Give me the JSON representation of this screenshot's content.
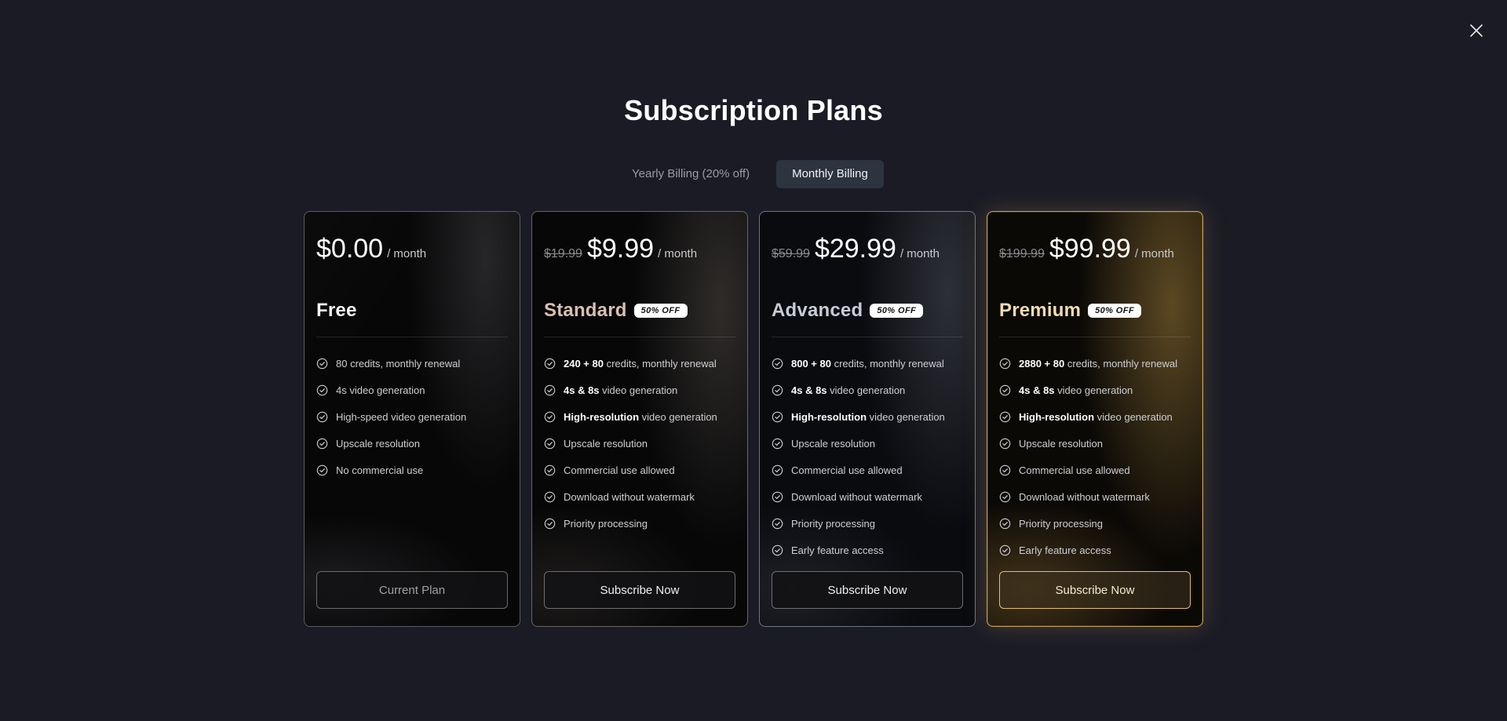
{
  "title": "Subscription Plans",
  "billing": {
    "yearly_label": "Yearly Billing (20% off)",
    "monthly_label": "Monthly Billing",
    "selected": "monthly"
  },
  "icons": {
    "close": "close-icon",
    "check": "check-circle-icon"
  },
  "colors": {
    "background": "#1b1b26",
    "premium_accent": "#c7a25d",
    "toggle_active": "#2c3440"
  },
  "plans": [
    {
      "name": "Free",
      "old_price": "",
      "price": "$0.00",
      "per": "/ month",
      "badge": "",
      "features": [
        {
          "bold": "",
          "text": "80 credits, monthly renewal"
        },
        {
          "bold": "",
          "text": "4s video generation"
        },
        {
          "bold": "",
          "text": "High-speed video generation"
        },
        {
          "bold": "",
          "text": "Upscale resolution"
        },
        {
          "bold": "",
          "text": "No commercial use"
        }
      ],
      "cta": "Current Plan"
    },
    {
      "name": "Standard",
      "old_price": "$19.99",
      "price": "$9.99",
      "per": "/ month",
      "badge": "50% OFF",
      "features": [
        {
          "bold": "240 + 80",
          "text": " credits, monthly renewal"
        },
        {
          "bold": "4s & 8s",
          "text": " video generation"
        },
        {
          "bold": "High-resolution",
          "text": " video generation"
        },
        {
          "bold": "",
          "text": "Upscale resolution"
        },
        {
          "bold": "",
          "text": "Commercial use allowed"
        },
        {
          "bold": "",
          "text": "Download without watermark"
        },
        {
          "bold": "",
          "text": "Priority processing"
        }
      ],
      "cta": "Subscribe Now"
    },
    {
      "name": "Advanced",
      "old_price": "$59.99",
      "price": "$29.99",
      "per": "/ month",
      "badge": "50% OFF",
      "features": [
        {
          "bold": "800 + 80",
          "text": " credits, monthly renewal"
        },
        {
          "bold": "4s & 8s",
          "text": " video generation"
        },
        {
          "bold": "High-resolution",
          "text": " video generation"
        },
        {
          "bold": "",
          "text": "Upscale resolution"
        },
        {
          "bold": "",
          "text": "Commercial use allowed"
        },
        {
          "bold": "",
          "text": "Download without watermark"
        },
        {
          "bold": "",
          "text": "Priority processing"
        },
        {
          "bold": "",
          "text": "Early feature access"
        }
      ],
      "cta": "Subscribe Now"
    },
    {
      "name": "Premium",
      "old_price": "$199.99",
      "price": "$99.99",
      "per": "/ month",
      "badge": "50% OFF",
      "features": [
        {
          "bold": "2880 + 80",
          "text": " credits, monthly renewal"
        },
        {
          "bold": "4s & 8s",
          "text": " video generation"
        },
        {
          "bold": "High-resolution",
          "text": " video generation"
        },
        {
          "bold": "",
          "text": "Upscale resolution"
        },
        {
          "bold": "",
          "text": "Commercial use allowed"
        },
        {
          "bold": "",
          "text": "Download without watermark"
        },
        {
          "bold": "",
          "text": "Priority processing"
        },
        {
          "bold": "",
          "text": "Early feature access"
        }
      ],
      "cta": "Subscribe Now"
    }
  ]
}
